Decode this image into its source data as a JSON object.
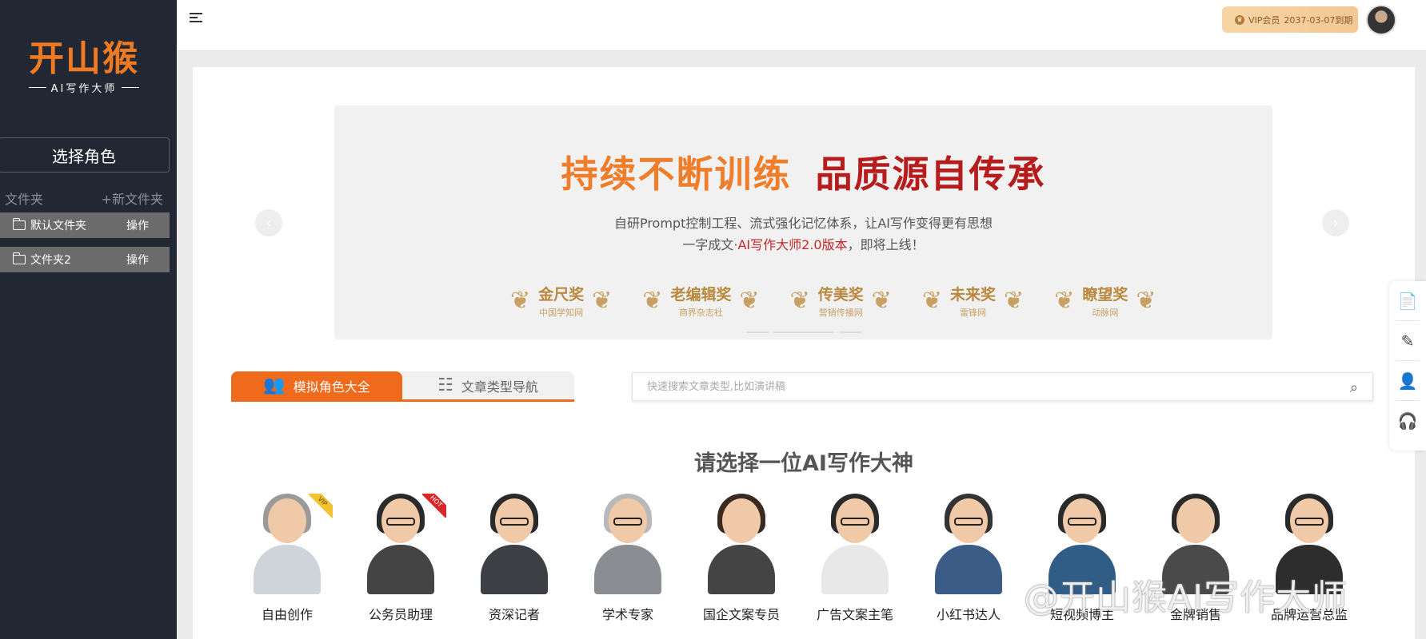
{
  "sidebar": {
    "logo_main": "开山猴",
    "logo_sub": "AI写作大师",
    "select_role": "选择角色",
    "folder_label": "文件夹",
    "new_folder": "+新文件夹",
    "folders": [
      {
        "name": "默认文件夹",
        "op": "操作"
      },
      {
        "name": "文件夹2",
        "op": "操作"
      }
    ]
  },
  "header": {
    "vip_label": "VIP会员",
    "vip_expiry": "2037-03-07到期"
  },
  "banner": {
    "title_orange": "持续不断训练",
    "title_red": "品质源自传承",
    "line1": "自研Prompt控制工程、流式强化记忆体系，让AI写作变得更有思想",
    "line2_prefix": "一字成文·",
    "line2_highlight": "AI写作大师2.0版本",
    "line2_suffix": "，即将上线！",
    "awards": [
      {
        "name": "金尺奖",
        "source": "中国学知网"
      },
      {
        "name": "老编辑奖",
        "source": "商界杂志社"
      },
      {
        "name": "传美奖",
        "source": "营销传播网"
      },
      {
        "name": "未来奖",
        "source": "雷锋网"
      },
      {
        "name": "瞭望奖",
        "source": "动脉网"
      }
    ]
  },
  "tabs": {
    "active": "模拟角色大全",
    "inactive": "文章类型导航"
  },
  "search": {
    "placeholder": "快速搜索文章类型,比如演讲稿"
  },
  "section_title": "请选择一位AI写作大神",
  "roles": [
    {
      "name": "自由创作",
      "ribbon": "VIP",
      "ribbon_color": "#f2c230"
    },
    {
      "name": "公务员助理",
      "ribbon": "HOT",
      "ribbon_color": "#d9262a"
    },
    {
      "name": "资深记者"
    },
    {
      "name": "学术专家"
    },
    {
      "name": "国企文案专员"
    },
    {
      "name": "广告文案主笔"
    },
    {
      "name": "小红书达人"
    },
    {
      "name": "短视频博主"
    },
    {
      "name": "金牌销售"
    },
    {
      "name": "品牌运营总监"
    }
  ],
  "watermark": "@开山猴AI写作大师",
  "colors": {
    "accent": "#ef6a1a",
    "sidebar_bg": "#222833",
    "banner_red": "#b71c1c"
  },
  "icons": {
    "float_bar": [
      "document-question-icon",
      "edit-icon",
      "users-icon",
      "headset-icon"
    ]
  }
}
